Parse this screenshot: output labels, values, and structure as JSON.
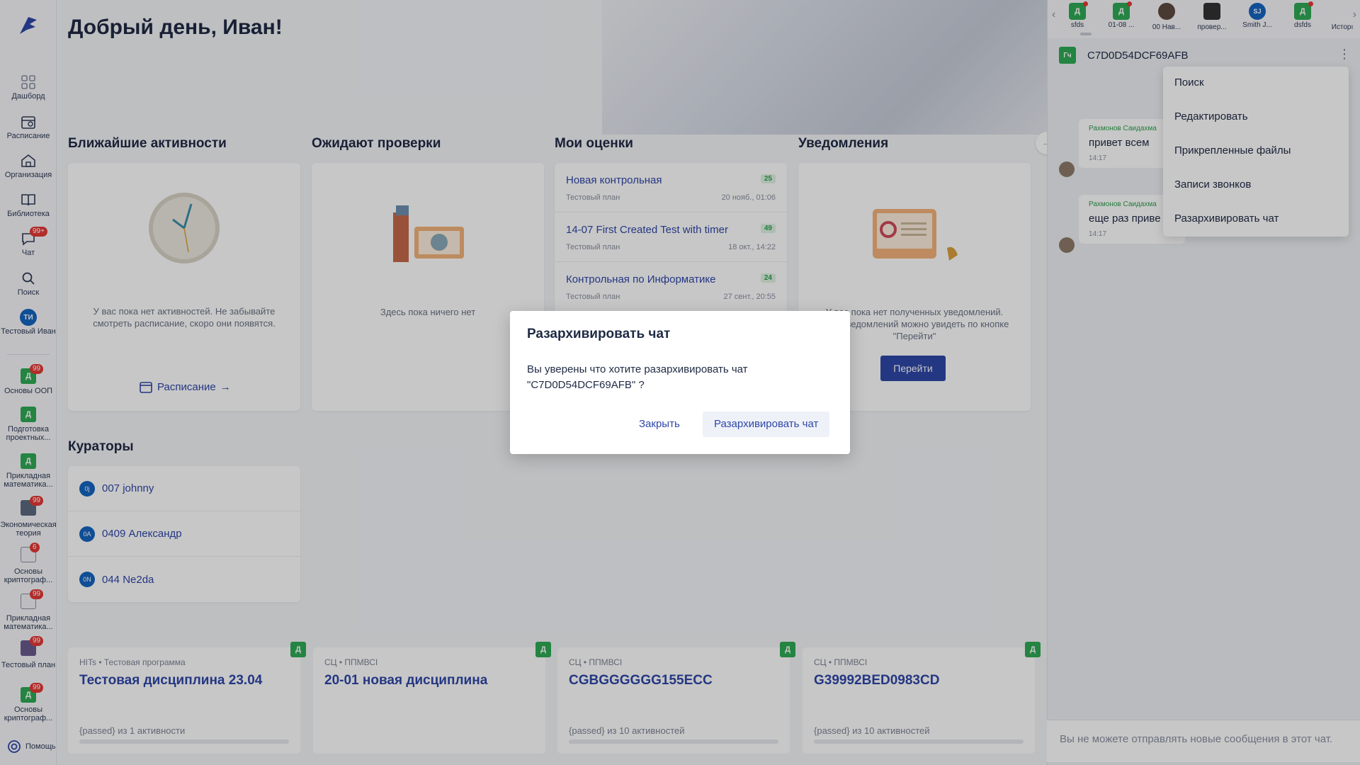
{
  "sidebar": {
    "items": [
      {
        "label": "Дашборд",
        "icon": "grid-icon"
      },
      {
        "label": "Расписание",
        "icon": "calendar-icon"
      },
      {
        "label": "Организация",
        "icon": "home-icon"
      },
      {
        "label": "Библиотека",
        "icon": "book-icon"
      },
      {
        "label": "Чат",
        "icon": "chat-icon",
        "badge": "99+"
      },
      {
        "label": "Поиск",
        "icon": "search-icon"
      },
      {
        "label": "Тестовый Иван",
        "avatar": "ТИ"
      }
    ],
    "courses": [
      {
        "label": "Основы ООП",
        "letter": "Д",
        "badge": "99"
      },
      {
        "label": "Подготовка проектных...",
        "letter": "Д",
        "badge": ""
      },
      {
        "label": "Прикладная математика...",
        "letter": "Д",
        "badge": ""
      },
      {
        "label": "Экономическая теория",
        "letter": "",
        "badge": "99"
      },
      {
        "label": "Основы криптограф...",
        "letter": "",
        "badge": "6"
      },
      {
        "label": "Прикладная математика...",
        "letter": "",
        "badge": "99"
      },
      {
        "label": "Тестовый план",
        "letter": "",
        "badge": "99"
      },
      {
        "label": "Основы криптограф...",
        "letter": "Д",
        "badge": "99"
      }
    ],
    "help": "Помощь"
  },
  "main": {
    "greeting": "Добрый день, Иван!",
    "sections": {
      "activities": "Ближайшие активности",
      "pending": "Ожидают проверки",
      "grades": "Мои оценки",
      "notifications": "Уведомления",
      "curators": "Кураторы"
    },
    "activities_empty": "У вас пока нет активностей. Не забывайте смотреть расписание, скоро они появятся.",
    "schedule_link": "Расписание",
    "pending_empty": "Здесь пока ничего нет",
    "grades": [
      {
        "title": "Новая контрольная",
        "plan": "Тестовый план",
        "date": "20 нояб., 01:06",
        "score": "25"
      },
      {
        "title": "14-07 First Created Test with timer",
        "plan": "Тестовый план",
        "date": "18 окт., 14:22",
        "score": "49"
      },
      {
        "title": "Контрольная по Информатике",
        "plan": "Тестовый план",
        "date": "27 сент., 20:55",
        "score": "24"
      }
    ],
    "notifications_empty_1": "У вас пока нет полученных уведомлений.",
    "notifications_empty_2": "всех уведомлений можно увидеть по кнопке \"Перейти\"",
    "notifications_button": "Перейти",
    "curators": [
      {
        "initials": "0j",
        "name": "007 johnny"
      },
      {
        "initials": "0А",
        "name": "0409 Александр"
      },
      {
        "initials": "0N",
        "name": "044 Ne2da"
      }
    ],
    "disciplines": [
      {
        "meta": "HITs • Тестовая программа",
        "name": "Тестовая дисциплина 23.04",
        "progress": "{passed} из 1 активности",
        "tag": "Д"
      },
      {
        "meta": "СЦ • ППМВСI",
        "name": "20-01 новая дисциплина",
        "progress": "",
        "tag": "Д"
      },
      {
        "meta": "СЦ • ППМВСI",
        "name": "CGBGGGGGG155ECC",
        "progress": "{passed} из 10 активностей",
        "tag": "Д"
      },
      {
        "meta": "СЦ • ППМВСI",
        "name": "G39992BED0983CD",
        "progress": "{passed} из 10 активностей",
        "tag": "Д"
      }
    ]
  },
  "chat": {
    "tabs": [
      {
        "name": "sfds",
        "letter": "Д",
        "color": "#2faa55",
        "dot": true
      },
      {
        "name": "01-08 ...",
        "letter": "Д",
        "color": "#2faa55",
        "dot": true
      },
      {
        "name": "00 Нав...",
        "letter": "",
        "color": "#5d4a3f",
        "dot": false
      },
      {
        "name": "провер...",
        "letter": "",
        "color": "#333333",
        "dot": false
      },
      {
        "name": "Smith J...",
        "letter": "SJ",
        "color": "#1565c0",
        "dot": false
      },
      {
        "name": "dsfds",
        "letter": "Д",
        "color": "#2faa55",
        "dot": true
      },
      {
        "name": "Исторı",
        "letter": "",
        "color": "#2faa55",
        "dot": false
      }
    ],
    "header": {
      "badge": "Гч",
      "title": "C7D0D54DCF69AFB"
    },
    "messages": [
      {
        "author": "Рахмонов Саидахма",
        "text": "привет всем",
        "time": "14:17"
      },
      {
        "author": "Рахмонов Саидахма",
        "text": "еще раз приве",
        "time": "14:17"
      }
    ],
    "menu": [
      "Поиск",
      "Редактировать",
      "Прикрепленные файлы",
      "Записи звонков",
      "Разархивировать чат"
    ],
    "footer": "Вы не можете отправлять новые сообщения в этот чат."
  },
  "dialog": {
    "title": "Разархивировать чат",
    "body": "Вы уверены что хотите разархивировать чат \"C7D0D54DCF69AFB\" ?",
    "cancel": "Закрыть",
    "confirm": "Разархивировать чат"
  }
}
